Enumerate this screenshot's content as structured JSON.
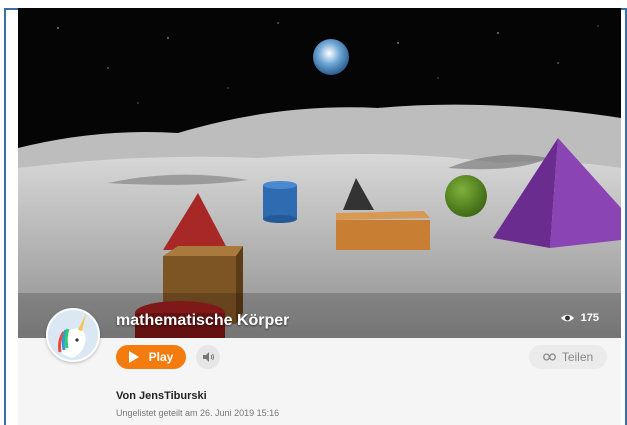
{
  "project": {
    "title": "mathematische Körper",
    "views": "175",
    "author": "Von JensTiburski",
    "meta": "Ungelistet geteilt am 26. Juni 2019 15:16"
  },
  "actions": {
    "play_label": "Play",
    "share_label": "Teilen"
  },
  "icons": {
    "views": "eye-icon",
    "play": "play-triangle-icon",
    "sound": "speaker-icon",
    "share": "link-icon"
  },
  "colors": {
    "accent": "#f47b0e",
    "frame": "#3b6ea5",
    "background": "#f5f5f5"
  }
}
